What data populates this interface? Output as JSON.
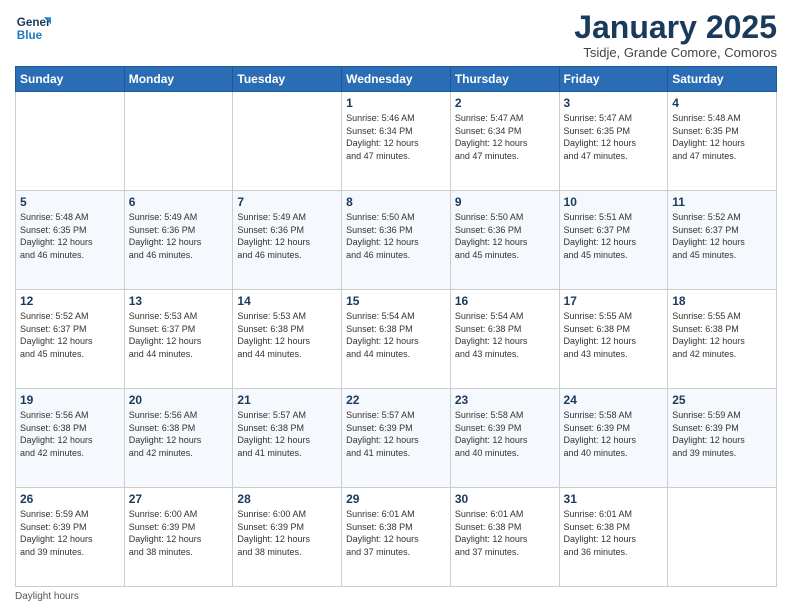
{
  "header": {
    "logo_line1": "General",
    "logo_line2": "Blue",
    "month_title": "January 2025",
    "subtitle": "Tsidje, Grande Comore, Comoros"
  },
  "days_of_week": [
    "Sunday",
    "Monday",
    "Tuesday",
    "Wednesday",
    "Thursday",
    "Friday",
    "Saturday"
  ],
  "weeks": [
    [
      {
        "day": "",
        "info": ""
      },
      {
        "day": "",
        "info": ""
      },
      {
        "day": "",
        "info": ""
      },
      {
        "day": "1",
        "info": "Sunrise: 5:46 AM\nSunset: 6:34 PM\nDaylight: 12 hours\nand 47 minutes."
      },
      {
        "day": "2",
        "info": "Sunrise: 5:47 AM\nSunset: 6:34 PM\nDaylight: 12 hours\nand 47 minutes."
      },
      {
        "day": "3",
        "info": "Sunrise: 5:47 AM\nSunset: 6:35 PM\nDaylight: 12 hours\nand 47 minutes."
      },
      {
        "day": "4",
        "info": "Sunrise: 5:48 AM\nSunset: 6:35 PM\nDaylight: 12 hours\nand 47 minutes."
      }
    ],
    [
      {
        "day": "5",
        "info": "Sunrise: 5:48 AM\nSunset: 6:35 PM\nDaylight: 12 hours\nand 46 minutes."
      },
      {
        "day": "6",
        "info": "Sunrise: 5:49 AM\nSunset: 6:36 PM\nDaylight: 12 hours\nand 46 minutes."
      },
      {
        "day": "7",
        "info": "Sunrise: 5:49 AM\nSunset: 6:36 PM\nDaylight: 12 hours\nand 46 minutes."
      },
      {
        "day": "8",
        "info": "Sunrise: 5:50 AM\nSunset: 6:36 PM\nDaylight: 12 hours\nand 46 minutes."
      },
      {
        "day": "9",
        "info": "Sunrise: 5:50 AM\nSunset: 6:36 PM\nDaylight: 12 hours\nand 45 minutes."
      },
      {
        "day": "10",
        "info": "Sunrise: 5:51 AM\nSunset: 6:37 PM\nDaylight: 12 hours\nand 45 minutes."
      },
      {
        "day": "11",
        "info": "Sunrise: 5:52 AM\nSunset: 6:37 PM\nDaylight: 12 hours\nand 45 minutes."
      }
    ],
    [
      {
        "day": "12",
        "info": "Sunrise: 5:52 AM\nSunset: 6:37 PM\nDaylight: 12 hours\nand 45 minutes."
      },
      {
        "day": "13",
        "info": "Sunrise: 5:53 AM\nSunset: 6:37 PM\nDaylight: 12 hours\nand 44 minutes."
      },
      {
        "day": "14",
        "info": "Sunrise: 5:53 AM\nSunset: 6:38 PM\nDaylight: 12 hours\nand 44 minutes."
      },
      {
        "day": "15",
        "info": "Sunrise: 5:54 AM\nSunset: 6:38 PM\nDaylight: 12 hours\nand 44 minutes."
      },
      {
        "day": "16",
        "info": "Sunrise: 5:54 AM\nSunset: 6:38 PM\nDaylight: 12 hours\nand 43 minutes."
      },
      {
        "day": "17",
        "info": "Sunrise: 5:55 AM\nSunset: 6:38 PM\nDaylight: 12 hours\nand 43 minutes."
      },
      {
        "day": "18",
        "info": "Sunrise: 5:55 AM\nSunset: 6:38 PM\nDaylight: 12 hours\nand 42 minutes."
      }
    ],
    [
      {
        "day": "19",
        "info": "Sunrise: 5:56 AM\nSunset: 6:38 PM\nDaylight: 12 hours\nand 42 minutes."
      },
      {
        "day": "20",
        "info": "Sunrise: 5:56 AM\nSunset: 6:38 PM\nDaylight: 12 hours\nand 42 minutes."
      },
      {
        "day": "21",
        "info": "Sunrise: 5:57 AM\nSunset: 6:38 PM\nDaylight: 12 hours\nand 41 minutes."
      },
      {
        "day": "22",
        "info": "Sunrise: 5:57 AM\nSunset: 6:39 PM\nDaylight: 12 hours\nand 41 minutes."
      },
      {
        "day": "23",
        "info": "Sunrise: 5:58 AM\nSunset: 6:39 PM\nDaylight: 12 hours\nand 40 minutes."
      },
      {
        "day": "24",
        "info": "Sunrise: 5:58 AM\nSunset: 6:39 PM\nDaylight: 12 hours\nand 40 minutes."
      },
      {
        "day": "25",
        "info": "Sunrise: 5:59 AM\nSunset: 6:39 PM\nDaylight: 12 hours\nand 39 minutes."
      }
    ],
    [
      {
        "day": "26",
        "info": "Sunrise: 5:59 AM\nSunset: 6:39 PM\nDaylight: 12 hours\nand 39 minutes."
      },
      {
        "day": "27",
        "info": "Sunrise: 6:00 AM\nSunset: 6:39 PM\nDaylight: 12 hours\nand 38 minutes."
      },
      {
        "day": "28",
        "info": "Sunrise: 6:00 AM\nSunset: 6:39 PM\nDaylight: 12 hours\nand 38 minutes."
      },
      {
        "day": "29",
        "info": "Sunrise: 6:01 AM\nSunset: 6:38 PM\nDaylight: 12 hours\nand 37 minutes."
      },
      {
        "day": "30",
        "info": "Sunrise: 6:01 AM\nSunset: 6:38 PM\nDaylight: 12 hours\nand 37 minutes."
      },
      {
        "day": "31",
        "info": "Sunrise: 6:01 AM\nSunset: 6:38 PM\nDaylight: 12 hours\nand 36 minutes."
      },
      {
        "day": "",
        "info": ""
      }
    ]
  ],
  "footer_label": "Daylight hours"
}
